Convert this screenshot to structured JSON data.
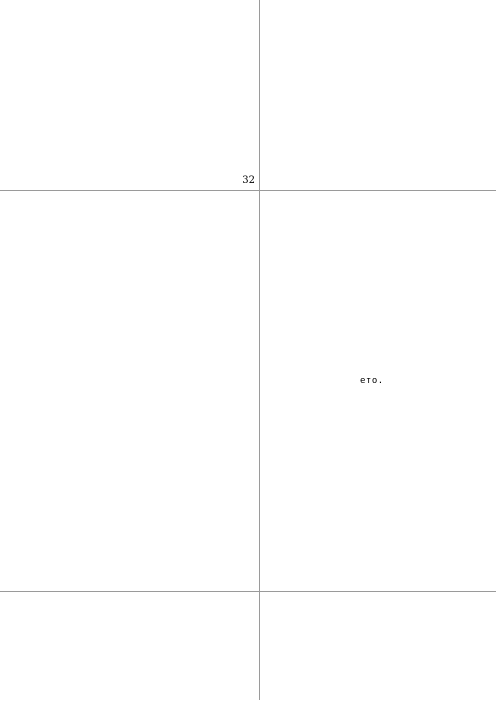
{
  "page": {
    "page_number": "32",
    "fragment": "ето."
  }
}
